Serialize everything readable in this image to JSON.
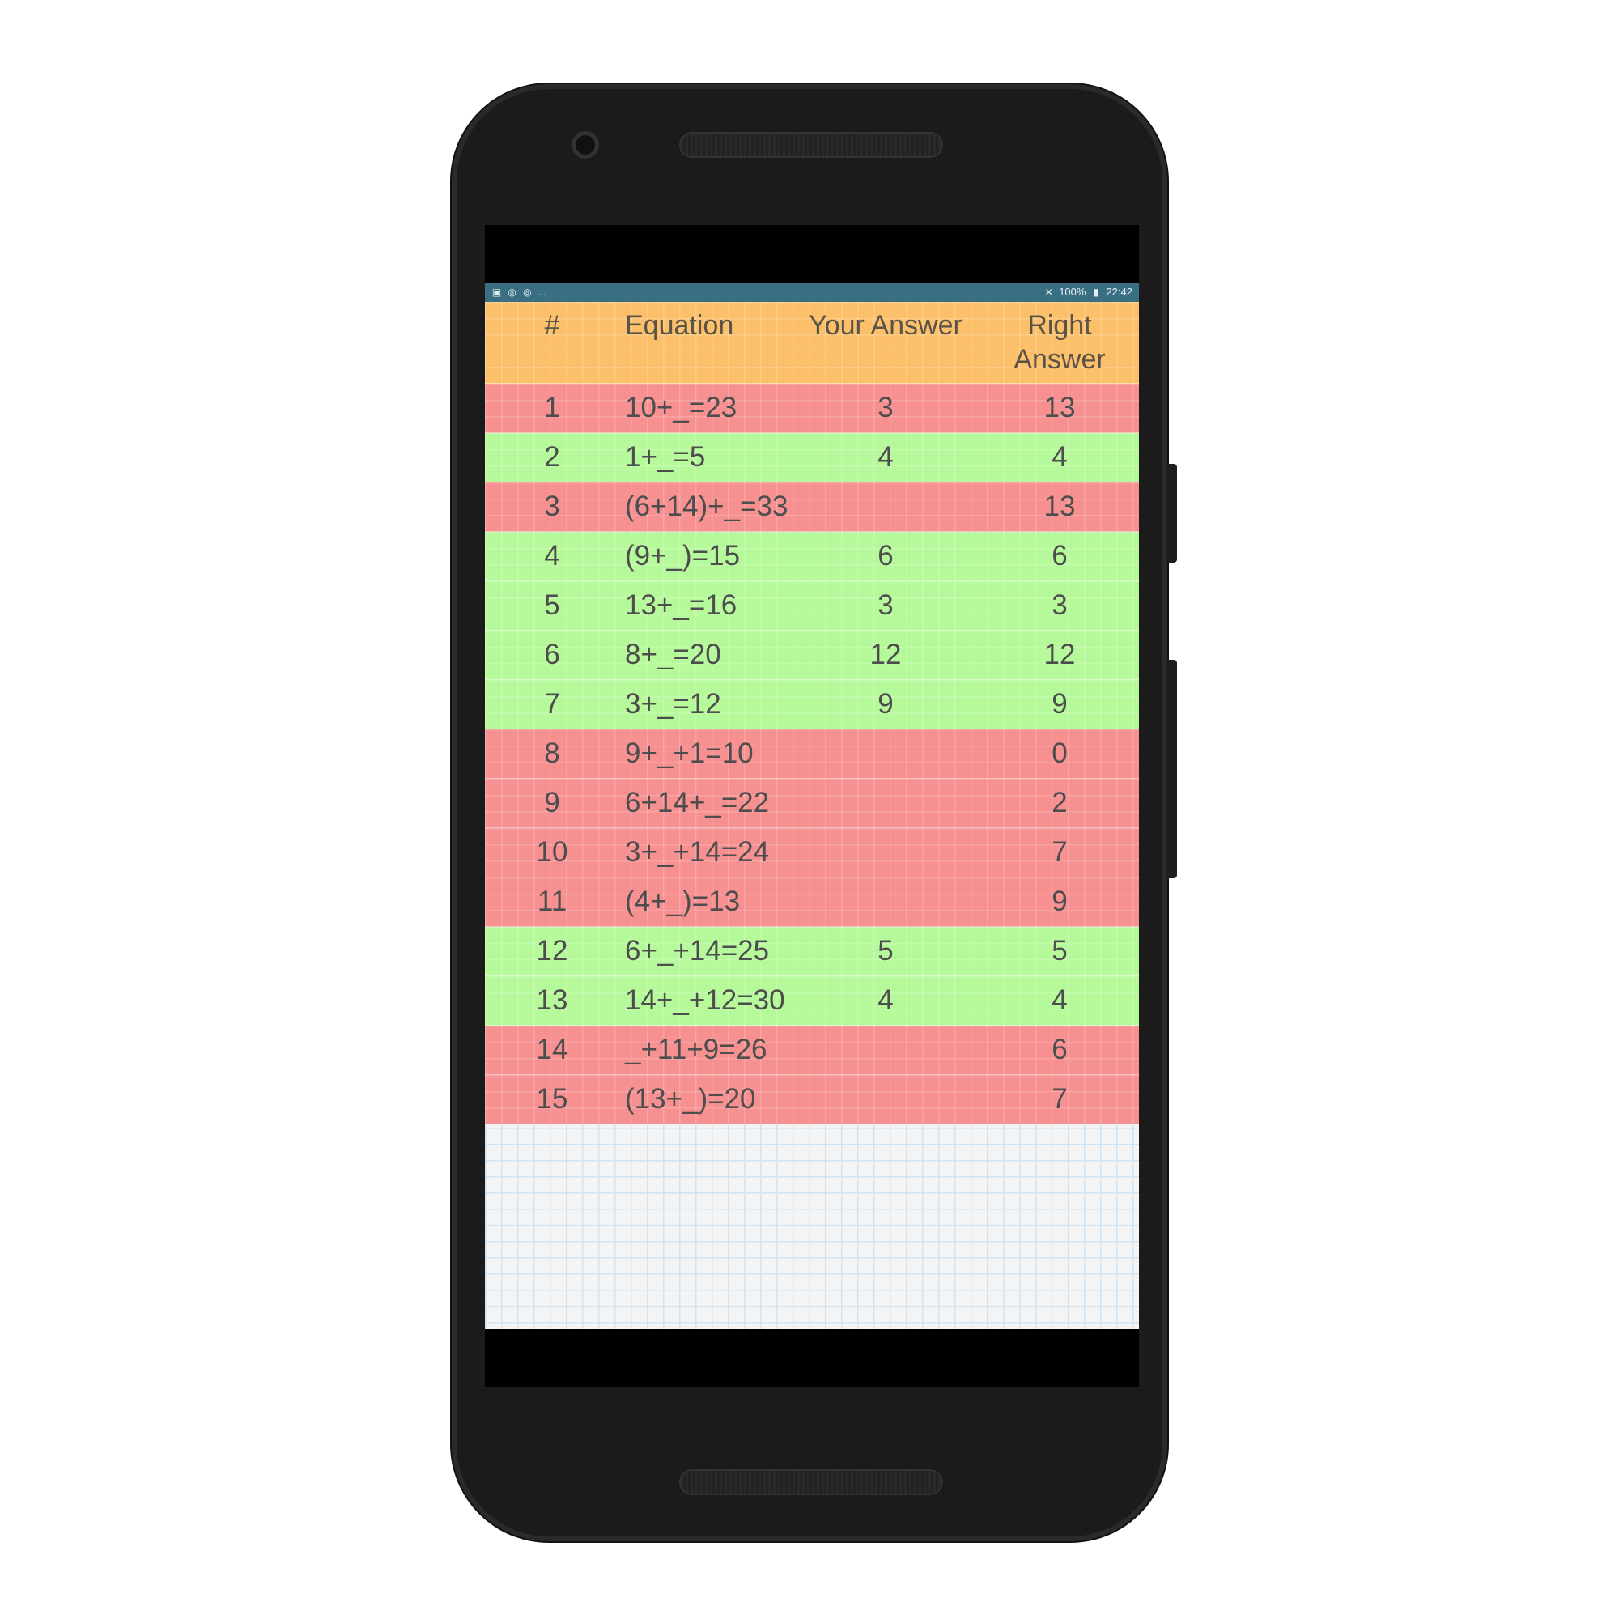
{
  "status_bar": {
    "left_icons": [
      "image-icon",
      "sync-icon",
      "sync-icon"
    ],
    "left_more": "...",
    "mute_icon": "mute-icon",
    "battery_text": "100%",
    "battery_icon": "battery-icon",
    "time": "22:42"
  },
  "colors": {
    "header": "#fcc06b",
    "wrong_row": "#f79090",
    "right_row": "#b6f99a",
    "status_bar": "#3a6e82"
  },
  "table": {
    "headers": {
      "num": "#",
      "equation": "Equation",
      "your_answer": "Your Answer",
      "right_answer_line1": "Right",
      "right_answer_line2": "Answer"
    },
    "rows": [
      {
        "num": "1",
        "equation": "10+_=23",
        "your_answer": "3",
        "right_answer": "13",
        "correct": false
      },
      {
        "num": "2",
        "equation": "1+_=5",
        "your_answer": "4",
        "right_answer": "4",
        "correct": true
      },
      {
        "num": "3",
        "equation": "(6+14)+_=33",
        "your_answer": "",
        "right_answer": "13",
        "correct": false
      },
      {
        "num": "4",
        "equation": "(9+_)=15",
        "your_answer": "6",
        "right_answer": "6",
        "correct": true
      },
      {
        "num": "5",
        "equation": "13+_=16",
        "your_answer": "3",
        "right_answer": "3",
        "correct": true
      },
      {
        "num": "6",
        "equation": "8+_=20",
        "your_answer": "12",
        "right_answer": "12",
        "correct": true
      },
      {
        "num": "7",
        "equation": "3+_=12",
        "your_answer": "9",
        "right_answer": "9",
        "correct": true
      },
      {
        "num": "8",
        "equation": "9+_+1=10",
        "your_answer": "",
        "right_answer": "0",
        "correct": false
      },
      {
        "num": "9",
        "equation": "6+14+_=22",
        "your_answer": "",
        "right_answer": "2",
        "correct": false
      },
      {
        "num": "10",
        "equation": "3+_+14=24",
        "your_answer": "",
        "right_answer": "7",
        "correct": false
      },
      {
        "num": "11",
        "equation": "(4+_)=13",
        "your_answer": "",
        "right_answer": "9",
        "correct": false
      },
      {
        "num": "12",
        "equation": "6+_+14=25",
        "your_answer": "5",
        "right_answer": "5",
        "correct": true
      },
      {
        "num": "13",
        "equation": "14+_+12=30",
        "your_answer": "4",
        "right_answer": "4",
        "correct": true
      },
      {
        "num": "14",
        "equation": "_+11+9=26",
        "your_answer": "",
        "right_answer": "6",
        "correct": false
      },
      {
        "num": "15",
        "equation": "(13+_)=20",
        "your_answer": "",
        "right_answer": "7",
        "correct": false
      }
    ]
  }
}
